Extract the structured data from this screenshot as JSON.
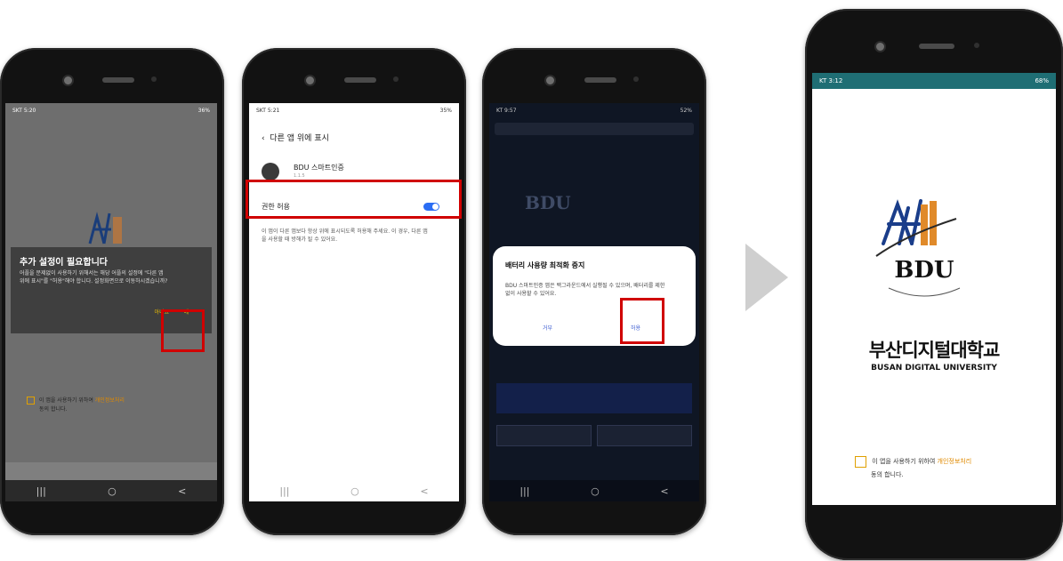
{
  "phone1": {
    "status_left": "SKT 5:20",
    "status_right": "36%",
    "dialog_title": "추가 설정이 필요합니다",
    "dialog_body": "어플을 문제없이 사용하기 위해서는 해당 어플의 설정에 \"다른 앱 위에 표시\"를 \"허용\"해야 합니다. 설정화면으로 이동하시겠습니까?",
    "no_label": "아니요",
    "yes_label": "예",
    "consent_pre": "이 앱을 사용하기 위하여",
    "consent_link": "개인정보처리",
    "consent_post": "동의 합니다."
  },
  "phone2": {
    "status_left": "SKT 5:21",
    "status_right": "35%",
    "header": "다른 앱 위에 표시",
    "app_name": "BDU 스마트인증",
    "app_version": "1.1.5",
    "permission_label": "권한 허용",
    "description": "이 앱이 다른 앱보다 항상 위에 표시되도록 허용해 주세요. 이 경우, 다른 앱을 사용할 때 방해가 될 수 있어요."
  },
  "phone3": {
    "status_left": "KT 9:57",
    "status_right": "52%",
    "logo_text": "BDU",
    "dialog_title": "배터리 사용량 최적화 중지",
    "dialog_body": "BDU 스마트인증 앱은 백그라운드에서 실행될 수 있으며, 배터리를 제한 없이 사용할 수 있어요.",
    "deny_label": "거부",
    "allow_label": "허용"
  },
  "phone4": {
    "status_left": "KT 3:12",
    "status_right": "68%",
    "logo_text": "BDU",
    "university_name_ko": "부산디지털대학교",
    "university_name_en": "BUSAN DIGITAL UNIVERSITY",
    "consent_pre": "이 앱을 사용하기 위하여",
    "consent_link": "개인정보처리",
    "consent_post": "동의 합니다."
  },
  "nav": {
    "recent": "|||",
    "home": "○",
    "back": "<"
  },
  "colors": {
    "highlight_red": "#d00000",
    "toggle_blue": "#2a6df4",
    "accent_orange": "#e08a00"
  }
}
